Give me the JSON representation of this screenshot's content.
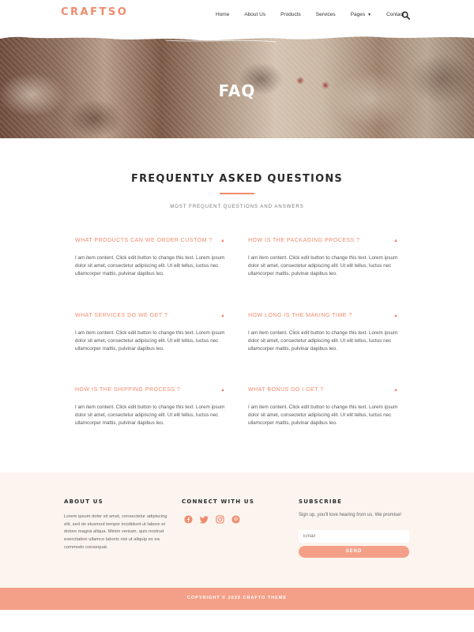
{
  "header": {
    "logo": "CRAFTSO",
    "nav": [
      "Home",
      "About Us",
      "Products",
      "Services",
      "Pages",
      "Contact"
    ],
    "search_icon": "search-icon"
  },
  "hero": {
    "title": "FAQ"
  },
  "faq_section": {
    "title": "FREQUENTLY ASKED QUESTIONS",
    "subtitle": "MOST FREQUENT QUESTIONS AND ANSWERS",
    "items": [
      {
        "question": "WHAT PRODUCTS CAN WE ORDER CUSTOM ?",
        "answer": "I am item content. Click edit button to change this text. Lorem ipsum dolor sit amet, consectetur adipiscing elit. Ut elit tellus, luctus nec ullamcorper mattis, pulvinar dapibus leo.",
        "toggle": "▲"
      },
      {
        "question": "HOW IS THE PACKAGING PROCESS ?",
        "answer": "I am item content. Click edit button to change this text. Lorem ipsum dolor sit amet, consectetur adipiscing elit. Ut elit tellus, luctus nec ullamcorper mattis, pulvinar dapibus leo.",
        "toggle": "▲"
      },
      {
        "question": "WHAT SERVICES DO WE GET ?",
        "answer": "I am item content. Click edit button to change this text. Lorem ipsum dolor sit amet, consectetur adipiscing elit. Ut elit tellus, luctus nec ullamcorper mattis, pulvinar dapibus leo.",
        "toggle": "▲"
      },
      {
        "question": "HOW LONG IS THE MAKING TIME ?",
        "answer": "I am item content. Click edit button to change this text. Lorem ipsum dolor sit amet, consectetur adipiscing elit. Ut elit tellus, luctus nec ullamcorper mattis, pulvinar dapibus leo.",
        "toggle": "▲"
      },
      {
        "question": "HOW IS THE SHIPPING PROCESS ?",
        "answer": "I am item content. Click edit button to change this text. Lorem ipsum dolor sit amet, consectetur adipiscing elit. Ut elit tellus, luctus nec ullamcorper mattis, pulvinar dapibus leo.",
        "toggle": "▲"
      },
      {
        "question": "WHAT BONUS DO I GET ?",
        "answer": "I am item content. Click edit button to change this text. Lorem ipsum dolor sit amet, consectetur adipiscing elit. Ut elit tellus, luctus nec ullamcorper mattis, pulvinar dapibus leo.",
        "toggle": "▲"
      }
    ]
  },
  "footer": {
    "about_title": "ABOUT US",
    "about_text": "Lorem ipsum dolor sit amet, consectetur adipiscing elit, sed do eiusmod tempor incididunt ut labore et dolore magna aliqua. Minim veniam, quis nostrud exercitation ullamco laboris nisi ut aliquip ex ea commodo consequat.",
    "connect_title": "CONNECT WITH US",
    "socials": [
      "facebook-icon",
      "twitter-icon",
      "instagram-icon",
      "pinterest-icon"
    ],
    "subscribe_title": "SUBSCRIBE",
    "subscribe_text": "Sign up, you'll love hearing from us. We promise!",
    "email_placeholder": "Email",
    "send_label": "SEND",
    "copyright": "COPYRIGHT © 2020 CRAFTO THEME"
  },
  "colors": {
    "accent": "#f08a6c",
    "button": "#f4a088",
    "footer_bg": "#fcf4ef"
  }
}
